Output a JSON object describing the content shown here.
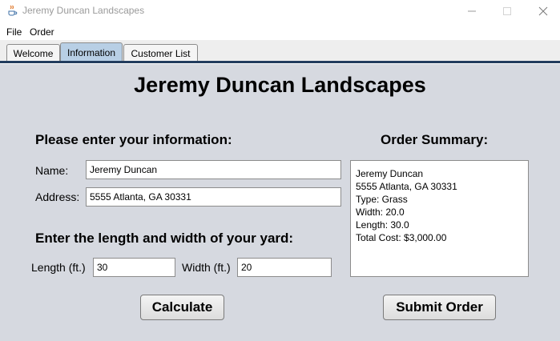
{
  "window": {
    "title": "Jeremy Duncan Landscapes",
    "icon": "java-cup-icon"
  },
  "menu": {
    "file": "File",
    "order": "Order"
  },
  "tabs": [
    {
      "label": "Welcome",
      "active": false
    },
    {
      "label": "Information",
      "active": true
    },
    {
      "label": "Customer List",
      "active": false
    }
  ],
  "main": {
    "heading": "Jeremy Duncan Landscapes",
    "info_label": "Please enter your information:",
    "summary_label": "Order Summary:",
    "yard_label": "Enter the length and width of your yard:",
    "name_label": "Name:",
    "address_label": "Address:",
    "length_label": "Length (ft.)",
    "width_label": "Width (ft.)"
  },
  "fields": {
    "name": "Jeremy Duncan",
    "address": "5555 Atlanta, GA 30331",
    "length": "30",
    "width": "20"
  },
  "summary": {
    "lines": [
      "Jeremy Duncan",
      "5555 Atlanta, GA 30331",
      "Type: Grass",
      "Width: 20.0",
      "Length: 30.0",
      "Total Cost: $3,000.00"
    ]
  },
  "buttons": {
    "calculate": "Calculate",
    "submit": "Submit Order"
  },
  "colors": {
    "panel_bg": "#d6d9e0",
    "active_tab": "#b8cfe5",
    "tab_underline": "#223c5e"
  }
}
